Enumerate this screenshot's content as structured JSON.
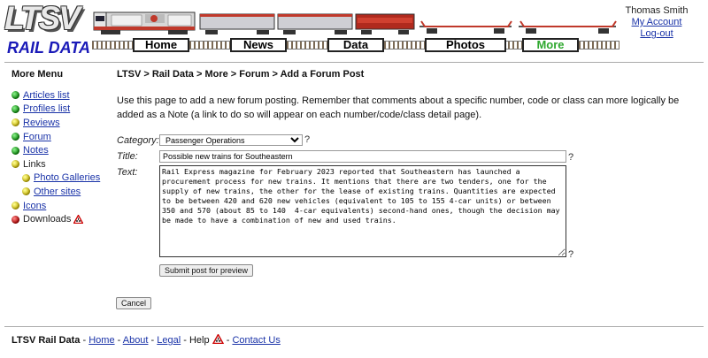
{
  "brand": {
    "logo_text": "LTSV",
    "logo_subtext": "RAIL DATA"
  },
  "colors": {
    "link": "#1a33a8",
    "active_nav": "#2fa82f",
    "logo_blue": "#1a1ab8"
  },
  "nav": {
    "items": [
      {
        "label": "Home"
      },
      {
        "label": "News"
      },
      {
        "label": "Data"
      },
      {
        "label": "Photos"
      },
      {
        "label": "More",
        "active": true
      }
    ]
  },
  "user": {
    "name": "Thomas Smith",
    "account_link": "My Account",
    "logout_link": "Log-out"
  },
  "sidebar": {
    "title": "More Menu",
    "items": [
      {
        "label": "Articles list",
        "dot": "green",
        "link": true
      },
      {
        "label": "Profiles list",
        "dot": "green",
        "link": true
      },
      {
        "label": "Reviews",
        "dot": "yellow",
        "link": true
      },
      {
        "label": "Forum",
        "dot": "green",
        "link": true
      },
      {
        "label": "Notes",
        "dot": "green",
        "link": true
      },
      {
        "label": "Links",
        "dot": "yellow",
        "link": false
      },
      {
        "label": "Photo Galleries",
        "dot": "yellow",
        "link": true,
        "sub": true
      },
      {
        "label": "Other sites",
        "dot": "yellow",
        "link": true,
        "sub": true
      },
      {
        "label": "Icons",
        "dot": "yellow",
        "link": true
      },
      {
        "label": "Downloads",
        "dot": "red",
        "link": false,
        "icon": "warning-icon"
      }
    ]
  },
  "main": {
    "breadcrumb": "LTSV > Rail Data > More > Forum > Add a Forum Post",
    "intro": "Use this page to add a new forum posting. Remember that comments about a specific number, code or class can more logically be added as a Note (a link to do so will appear on each number/code/class detail page).",
    "form": {
      "category_label": "Category:",
      "category_value": "Passenger Operations",
      "title_label": "Title:",
      "title_value": "Possible new trains for Southeastern",
      "text_label": "Text:",
      "text_value": "Rail Express magazine for February 2023 reported that Southeastern has launched a procurement process for new trains. It mentions that there are two tenders, one for the supply of new trains, the other for the lease of existing trains. Quantities are expected to be between 420 and 620 new vehicles (equivalent to 105 to 155 4-car units) or between 350 and 570 (about 85 to 140  4-car equivalents) second-hand ones, though the decision may be made to have a combination of new and used trains.",
      "help_mark": "?",
      "submit_label": "Submit post for preview",
      "cancel_label": "Cancel"
    }
  },
  "footer": {
    "site_name": "LTSV Rail Data",
    "sep": " - ",
    "links": [
      "Home",
      "About",
      "Legal"
    ],
    "help_label": "Help",
    "contact_label": "Contact Us"
  }
}
